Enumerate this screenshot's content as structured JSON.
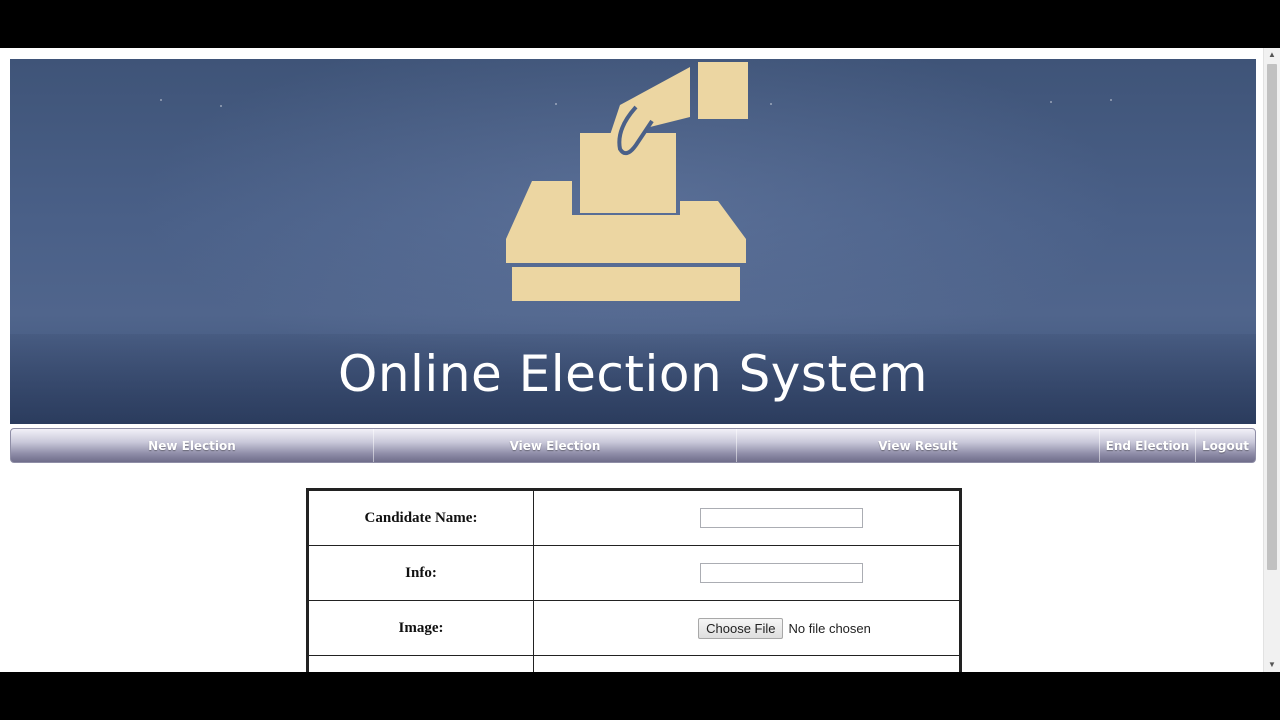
{
  "banner": {
    "title": "Online Election System",
    "logo_icon": "ballot-box-icon",
    "logo_color": "#ecd6a2",
    "background_color": "#4a6088"
  },
  "nav": {
    "items": [
      {
        "label": "New Election"
      },
      {
        "label": "View Election"
      },
      {
        "label": "View Result"
      },
      {
        "label": "End Election"
      },
      {
        "label": "Logout"
      }
    ]
  },
  "form": {
    "candidate_name_label": "Candidate Name:",
    "candidate_name_value": "",
    "info_label": "Info:",
    "info_value": "",
    "image_label": "Image:",
    "choose_file_label": "Choose File",
    "file_status": "No file chosen"
  },
  "scrollbar": {
    "up_icon": "scroll-up-arrow-icon",
    "down_icon": "scroll-down-arrow-icon"
  }
}
